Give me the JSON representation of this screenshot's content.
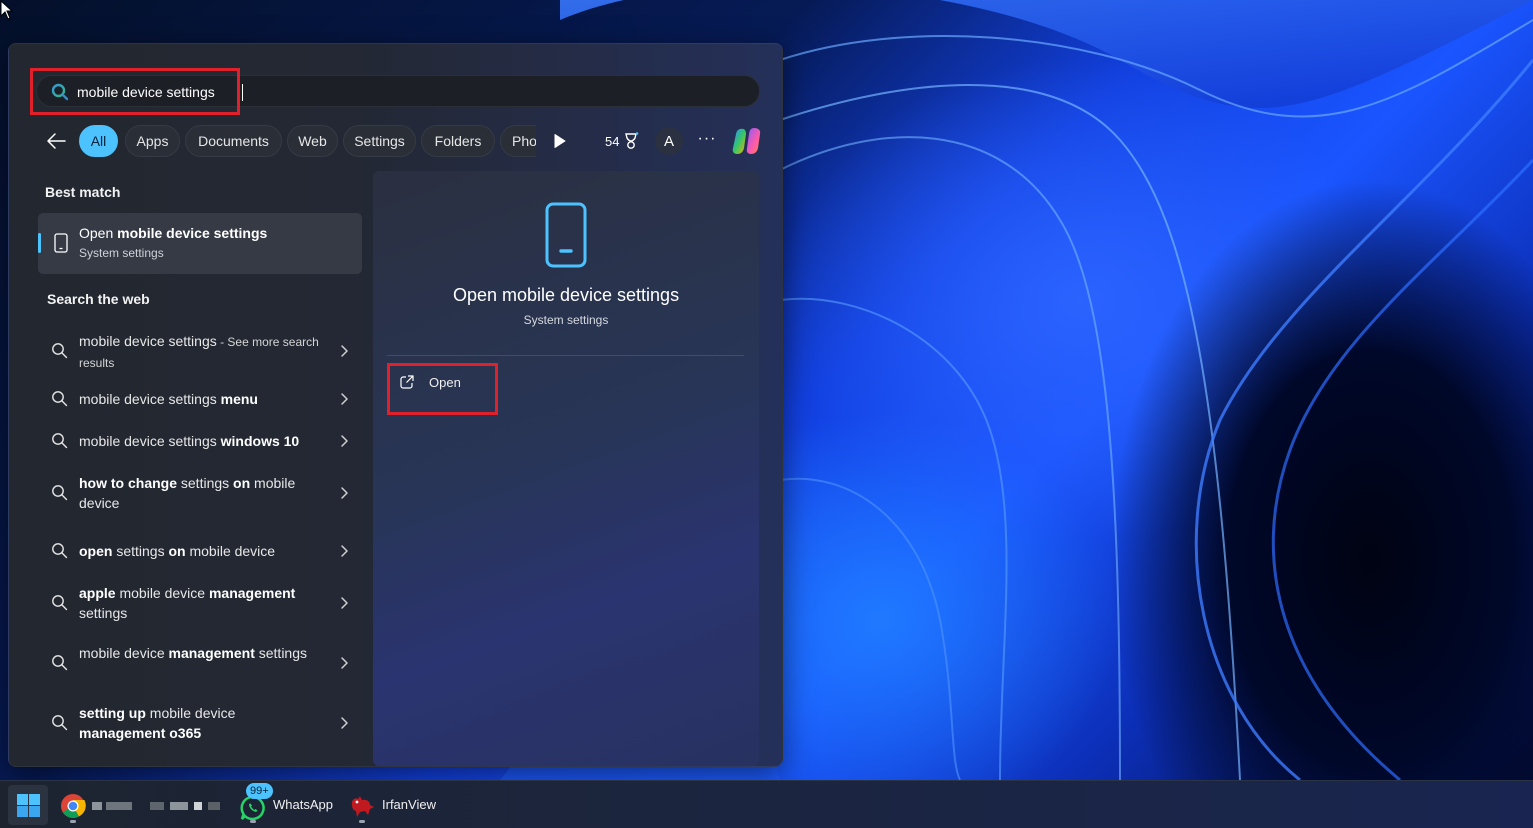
{
  "search": {
    "query": "mobile device settings",
    "icon": "search-icon"
  },
  "filters": {
    "back_icon": "arrow-left-icon",
    "chips": [
      {
        "label": "All",
        "active": true
      },
      {
        "label": "Apps",
        "active": false
      },
      {
        "label": "Documents",
        "active": false
      },
      {
        "label": "Web",
        "active": false
      },
      {
        "label": "Settings",
        "active": false
      },
      {
        "label": "Folders",
        "active": false
      },
      {
        "label": "Pho",
        "active": false
      }
    ],
    "play_icon": "play-icon",
    "rewards_points": "54",
    "rewards_icon": "trophy-icon",
    "avatar_initial": "A",
    "more_label": "···",
    "copilot_icon": "copilot-icon"
  },
  "best_match": {
    "heading": "Best match",
    "title_prefix": "Open ",
    "title_bold": "mobile device settings",
    "subtitle": "System settings",
    "icon": "phone-icon"
  },
  "web": {
    "heading": "Search the web",
    "items": [
      {
        "parts": [
          {
            "t": "mobile device settings",
            "b": false
          },
          {
            "t": " - See more search results",
            "b": false,
            "small": true
          }
        ]
      },
      {
        "parts": [
          {
            "t": "mobile device settings ",
            "b": false
          },
          {
            "t": "menu",
            "b": true
          }
        ]
      },
      {
        "parts": [
          {
            "t": "mobile device settings ",
            "b": false
          },
          {
            "t": "windows 10",
            "b": true
          }
        ]
      },
      {
        "parts": [
          {
            "t": "how to change",
            "b": true
          },
          {
            "t": " settings ",
            "b": false
          },
          {
            "t": "on",
            "b": true
          },
          {
            "t": " mobile device",
            "b": false
          }
        ]
      },
      {
        "parts": [
          {
            "t": "open",
            "b": true
          },
          {
            "t": " settings ",
            "b": false
          },
          {
            "t": "on",
            "b": true
          },
          {
            "t": " mobile device",
            "b": false
          }
        ]
      },
      {
        "parts": [
          {
            "t": "apple",
            "b": true
          },
          {
            "t": " mobile device ",
            "b": false
          },
          {
            "t": "management",
            "b": true
          },
          {
            "t": " settings",
            "b": false
          }
        ]
      },
      {
        "parts": [
          {
            "t": "mobile device ",
            "b": false
          },
          {
            "t": "management",
            "b": true
          },
          {
            "t": " settings",
            "b": false
          }
        ]
      },
      {
        "parts": [
          {
            "t": "setting up",
            "b": true
          },
          {
            "t": " mobile device ",
            "b": false
          },
          {
            "t": "management o365",
            "b": true
          }
        ]
      }
    ]
  },
  "preview": {
    "title": "Open mobile device settings",
    "subtitle": "System settings",
    "action_label": "Open",
    "action_icon": "open-external-icon"
  },
  "taskbar": {
    "apps": [
      {
        "name": "Chrome",
        "label": ""
      },
      {
        "name": "WhatsApp",
        "label": "WhatsApp",
        "badge": "99+"
      },
      {
        "name": "IrfanView",
        "label": "IrfanView"
      }
    ]
  },
  "colors": {
    "accent": "#4cc2ff",
    "highlight_box": "#e0202a"
  }
}
